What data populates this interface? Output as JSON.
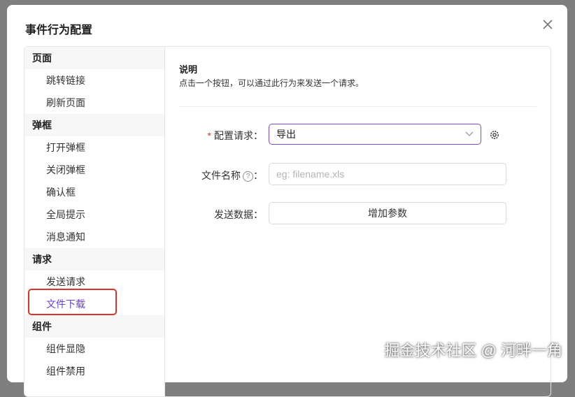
{
  "modal": {
    "title": "事件行为配置"
  },
  "sidebar": {
    "groups": [
      {
        "title": "页面",
        "items": [
          "跳转链接",
          "刷新页面"
        ]
      },
      {
        "title": "弹框",
        "items": [
          "打开弹框",
          "关闭弹框",
          "确认框",
          "全局提示",
          "消息通知"
        ]
      },
      {
        "title": "请求",
        "items": [
          "发送请求",
          "文件下载"
        ]
      },
      {
        "title": "组件",
        "items": [
          "组件显隐",
          "组件禁用"
        ]
      }
    ],
    "active_item": "文件下载"
  },
  "content": {
    "desc_title": "说明",
    "desc_text": "点击一个按钮，可以通过此行为来发送一个请求。",
    "fields": {
      "request_label": "配置请求",
      "request_value": "导出",
      "filename_label": "文件名称",
      "filename_placeholder": "eg: filename.xls",
      "send_data_label": "发送数据",
      "add_param_label": "增加参数"
    }
  },
  "watermark": "掘金技术社区 @ 河畔一角",
  "colors": {
    "accent": "#6a3fd8",
    "highlight": "#e0322b"
  }
}
